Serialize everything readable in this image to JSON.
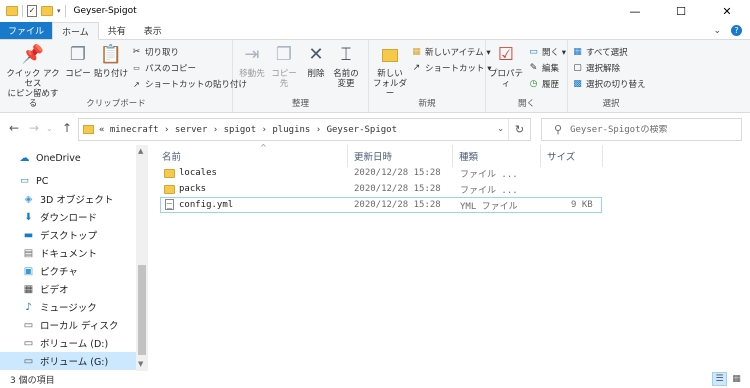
{
  "window": {
    "title": "Geyser-Spigot",
    "minimize": "—",
    "maximize": "☐",
    "close": "✕"
  },
  "tabs": {
    "file": "ファイル",
    "home": "ホーム",
    "share": "共有",
    "view": "表示"
  },
  "ribbon": {
    "clipboard": {
      "label": "クリップボード",
      "pin": "クイック アクセス\nにピン留めする",
      "copy": "コピー",
      "paste": "貼り付け",
      "cut": "切り取り",
      "copy_path": "パスのコピー",
      "paste_shortcut": "ショートカットの貼り付け"
    },
    "organize": {
      "label": "整理",
      "move_to": "移動先",
      "copy_to": "コピー先",
      "delete": "削除",
      "rename": "名前の\n変更"
    },
    "new": {
      "label": "新規",
      "new_folder": "新しい\nフォルダー",
      "new_item": "新しいアイテム ▾",
      "shortcut": "ショートカット ▾"
    },
    "open": {
      "label": "開く",
      "properties": "プロパティ",
      "open": "開く ▾",
      "edit": "編集",
      "history": "履歴"
    },
    "select": {
      "label": "選択",
      "select_all": "すべて選択",
      "select_none": "選択解除",
      "invert": "選択の切り替え"
    }
  },
  "address": {
    "path": "« minecraft › server › spigot › plugins › Geyser-Spigot",
    "search_placeholder": "Geyser-Spigotの検索"
  },
  "nav": {
    "items": [
      {
        "label": "OneDrive",
        "icon": "☁"
      },
      {
        "label": "PC",
        "icon": "🖥"
      },
      {
        "label": "3D オブジェクト",
        "icon": "◈"
      },
      {
        "label": "ダウンロード",
        "icon": "⬇"
      },
      {
        "label": "デスクトップ",
        "icon": "▬"
      },
      {
        "label": "ドキュメント",
        "icon": "▤"
      },
      {
        "label": "ピクチャ",
        "icon": "▣"
      },
      {
        "label": "ビデオ",
        "icon": "▦"
      },
      {
        "label": "ミュージック",
        "icon": "♪"
      },
      {
        "label": "ローカル ディスク",
        "icon": "▭"
      },
      {
        "label": "ボリューム (D:)",
        "icon": "▭"
      },
      {
        "label": "ボリューム (G:)",
        "icon": "▭"
      }
    ]
  },
  "columns": {
    "name": "名前",
    "modified": "更新日時",
    "type": "種類",
    "size": "サイズ"
  },
  "files": [
    {
      "name": "locales",
      "modified": "2020/12/28 15:28",
      "type": "ファイル ...",
      "size": ""
    },
    {
      "name": "packs",
      "modified": "2020/12/28 15:28",
      "type": "ファイル ...",
      "size": ""
    },
    {
      "name": "config.yml",
      "modified": "2020/12/28 15:28",
      "type": "YML ファイル",
      "size": "9 KB"
    }
  ],
  "status": {
    "count": "3 個の項目"
  },
  "colors": {
    "accent": "#1979ca",
    "folder": "#f5c94b",
    "selection": "#cce8ff",
    "focus_border": "#99d1ff"
  }
}
